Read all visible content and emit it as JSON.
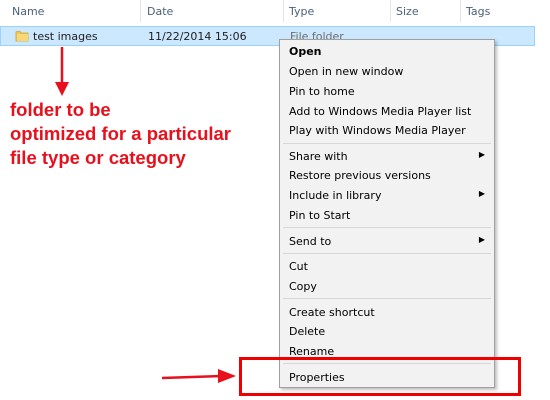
{
  "columns": {
    "name": "Name",
    "date": "Date",
    "type": "Type",
    "size": "Size",
    "tags": "Tags"
  },
  "file_row": {
    "name": "test images",
    "date": "11/22/2014 15:06",
    "type": "File folder"
  },
  "annotation": {
    "line1": "folder to be",
    "line2": "optimized for a particular",
    "line3": "file type or category"
  },
  "context_menu": {
    "open": "Open",
    "open_new_window": "Open in new window",
    "pin_home": "Pin to home",
    "add_wmp": "Add to Windows Media Player list",
    "play_wmp": "Play with Windows Media Player",
    "share_with": "Share with",
    "restore_versions": "Restore previous versions",
    "include_library": "Include in library",
    "pin_start": "Pin to Start",
    "send_to": "Send to",
    "cut": "Cut",
    "copy": "Copy",
    "create_shortcut": "Create shortcut",
    "delete": "Delete",
    "rename": "Rename",
    "properties": "Properties"
  },
  "colors": {
    "annotation": "#e8101c",
    "selection": "#cce8ff",
    "menu_bg": "#f2f2f2"
  },
  "icons": {
    "folder": "folder-icon",
    "submenu": "chevron-right-icon",
    "annotation_arrow": "red-arrow-icon"
  }
}
